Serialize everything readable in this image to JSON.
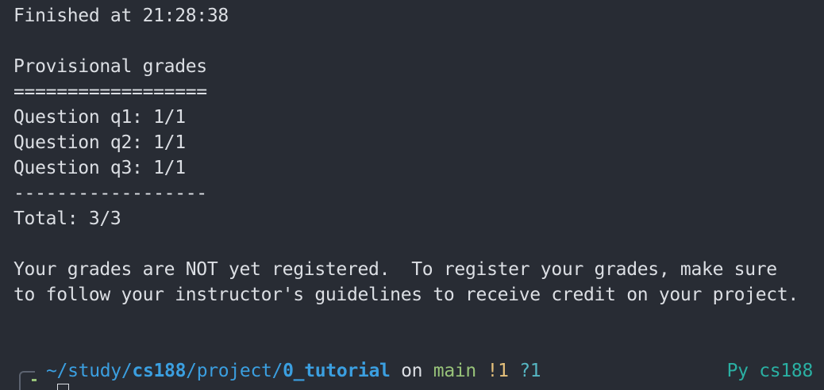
{
  "output": {
    "lines": [
      "Finished at 21:28:38",
      "",
      "Provisional grades",
      "==================",
      "Question q1: 1/1",
      "Question q2: 1/1",
      "Question q3: 1/1",
      "------------------",
      "Total: 3/3",
      "",
      "Your grades are NOT yet registered.  To register your grades, make sure",
      "to follow your instructor's guidelines to receive credit on your project."
    ]
  },
  "prompt": {
    "home": "~/",
    "dir1": "study/",
    "dir2": "cs188",
    "dir3": "/project/",
    "dir4": "0_tutorial",
    "on_word": " on ",
    "branch": "main",
    "modified": " !1",
    "untracked": " ?1",
    "env": "Py cs188"
  },
  "colors": {
    "background": "#282c34",
    "foreground": "#dcdfe4",
    "path": "#3b9fe0",
    "branch": "#98c379",
    "modified": "#e5c07b",
    "untracked": "#56b6c2",
    "env": "#2ab0a3"
  }
}
